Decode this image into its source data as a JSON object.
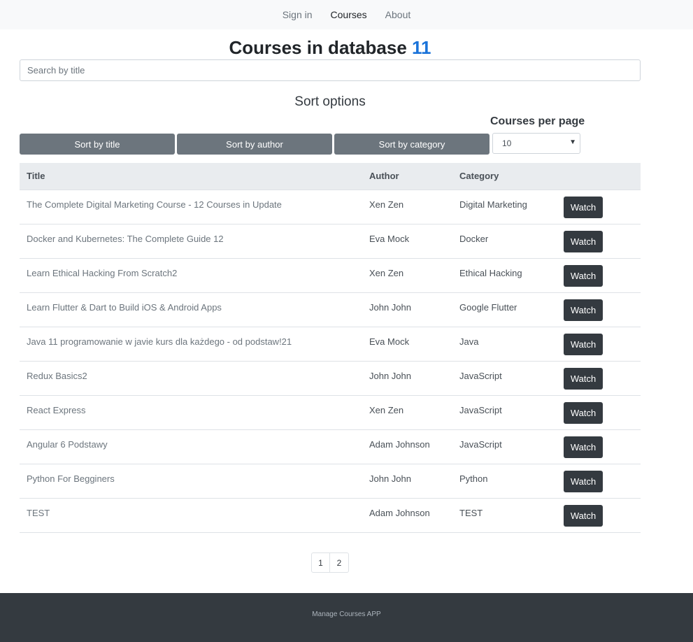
{
  "nav": {
    "items": [
      {
        "label": "Sign in",
        "active": false
      },
      {
        "label": "Courses",
        "active": true
      },
      {
        "label": "About",
        "active": false
      }
    ]
  },
  "header": {
    "title": "Courses in database",
    "count": "11"
  },
  "search": {
    "placeholder": "Search by title",
    "value": ""
  },
  "sort": {
    "heading": "Sort options",
    "buttons": [
      "Sort by title",
      "Sort by author",
      "Sort by category"
    ]
  },
  "per_page": {
    "label": "Courses per page",
    "selected": "10"
  },
  "table": {
    "columns": [
      "Title",
      "Author",
      "Category",
      ""
    ],
    "watch_label": "Watch",
    "rows": [
      {
        "title": "The Complete Digital Marketing Course - 12 Courses in Update",
        "author": "Xen Zen",
        "category": "Digital Marketing"
      },
      {
        "title": "Docker and Kubernetes: The Complete Guide 12",
        "author": "Eva Mock",
        "category": "Docker"
      },
      {
        "title": "Learn Ethical Hacking From Scratch2",
        "author": "Xen Zen",
        "category": "Ethical Hacking"
      },
      {
        "title": "Learn Flutter & Dart to Build iOS & Android Apps",
        "author": "John John",
        "category": "Google Flutter"
      },
      {
        "title": "Java 11 programowanie w javie kurs dla każdego - od podstaw!21",
        "author": "Eva Mock",
        "category": "Java"
      },
      {
        "title": "Redux Basics2",
        "author": "John John",
        "category": "JavaScript"
      },
      {
        "title": "React Express",
        "author": "Xen Zen",
        "category": "JavaScript"
      },
      {
        "title": "Angular 6 Podstawy",
        "author": "Adam Johnson",
        "category": "JavaScript"
      },
      {
        "title": "Python For Begginers",
        "author": "John John",
        "category": "Python"
      },
      {
        "title": "TEST",
        "author": "Adam Johnson",
        "category": "TEST"
      }
    ]
  },
  "pagination": {
    "pages": [
      "1",
      "2"
    ]
  },
  "footer": {
    "text": "Manage Courses APP"
  },
  "colors": {
    "accent": "#1a73d9",
    "sort_button": "#6c757d",
    "watch_button": "#343a40",
    "footer_bg": "#343a40"
  }
}
